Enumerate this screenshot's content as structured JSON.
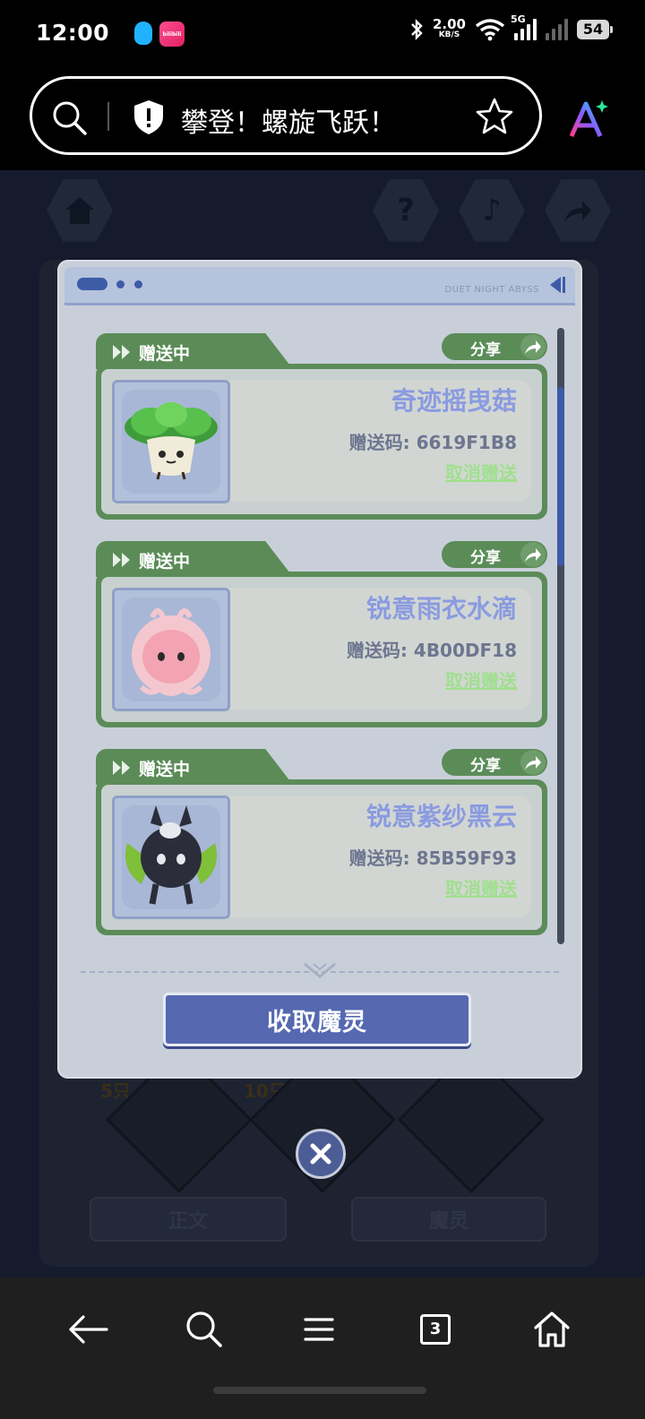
{
  "status_bar": {
    "time": "12:00",
    "speed_value": "2.00",
    "speed_unit": "KB/S",
    "network": "5G",
    "battery": "54",
    "bili_label": "bilibili"
  },
  "url_bar": {
    "title": "攀登！螺旋飞跃！"
  },
  "background": {
    "count_labels": [
      "5只",
      "10只"
    ],
    "tabs": [
      "正文",
      "魔灵"
    ]
  },
  "dialog": {
    "brand": "DUET NIGHT ABYSS",
    "gifts": [
      {
        "status": "赠送中",
        "share_label": "分享",
        "name": "奇迹摇曳菇",
        "code": "赠送码: 6619F1B8",
        "cancel": "取消赠送"
      },
      {
        "status": "赠送中",
        "share_label": "分享",
        "name": "锐意雨衣水滴",
        "code": "赠送码: 4B00DF18",
        "cancel": "取消赠送"
      },
      {
        "status": "赠送中",
        "share_label": "分享",
        "name": "锐意紫纱黑云",
        "code": "赠送码: 85B59F93",
        "cancel": "取消赠送"
      }
    ],
    "collect_button": "收取魔灵"
  },
  "bottom_nav": {
    "tab_count": "3"
  },
  "colors": {
    "accent_green": "#5b8c58",
    "accent_blue": "#5568b0",
    "name_blue": "#8a9be0",
    "cancel_green": "#9fe08e"
  },
  "icons": [
    "search-icon",
    "shield-icon",
    "star-icon",
    "ai-icon",
    "back-icon",
    "menu-icon",
    "home-icon",
    "close-icon",
    "share-icon",
    "question-icon",
    "music-icon"
  ]
}
